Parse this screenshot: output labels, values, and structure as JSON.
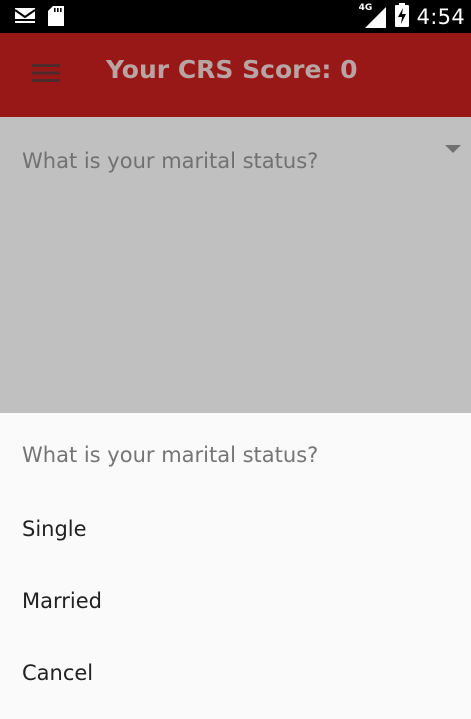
{
  "status_bar": {
    "network": "4G",
    "time": "4:54",
    "icons": [
      "mail-icon",
      "sd-card-icon",
      "signal-icon",
      "battery-charging-icon"
    ]
  },
  "app_bar": {
    "title": "Your CRS Score: 0",
    "menu_icon": "hamburger-menu-icon",
    "background": "#981818"
  },
  "form": {
    "marital_status_hint": "What is your marital status?",
    "dropdown_icon": "dropdown-arrow-icon"
  },
  "sheet": {
    "title": "What is your marital status?",
    "options": [
      "Single",
      "Married",
      "Cancel"
    ]
  }
}
